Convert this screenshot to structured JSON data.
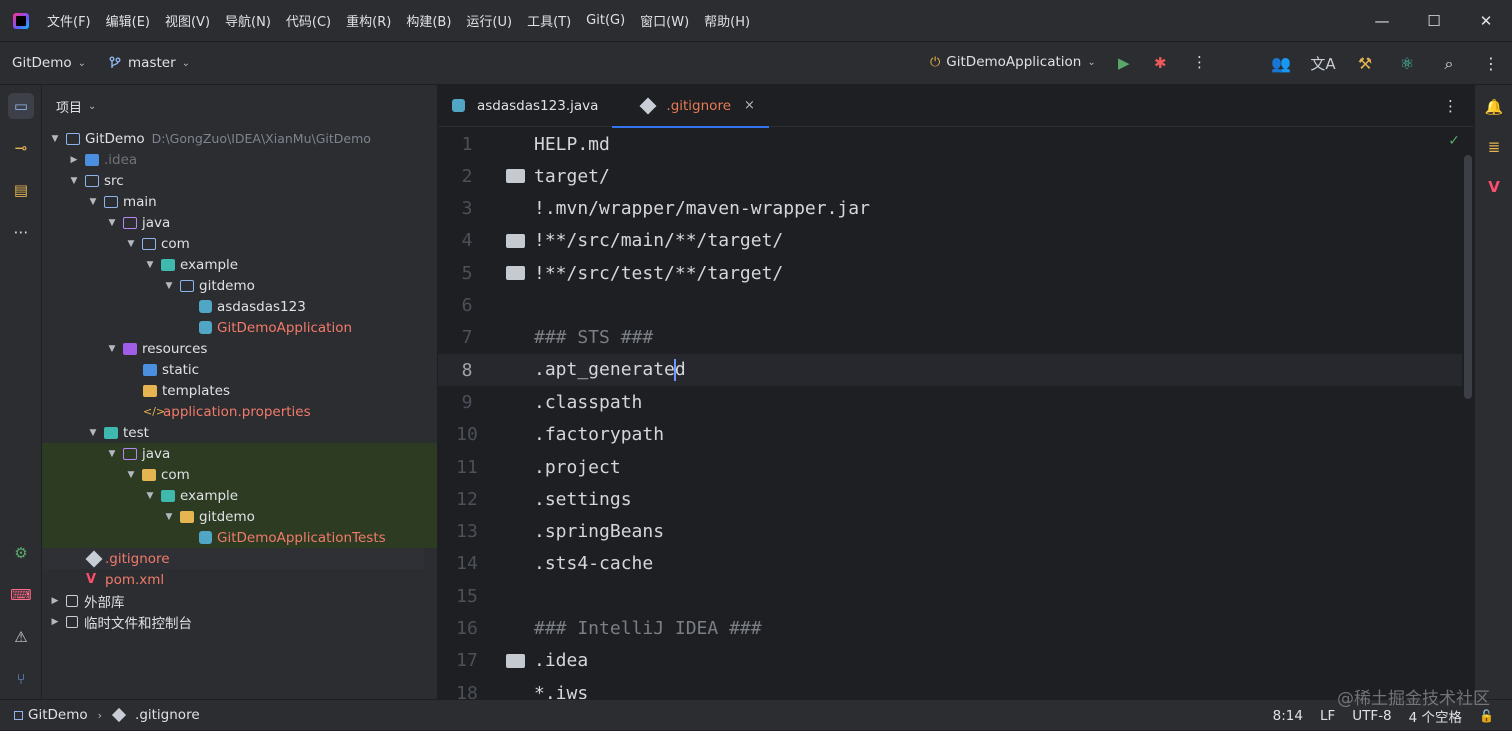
{
  "menu": [
    "文件(F)",
    "编辑(E)",
    "视图(V)",
    "导航(N)",
    "代码(C)",
    "重构(R)",
    "构建(B)",
    "运行(U)",
    "工具(T)",
    "Git(G)",
    "窗口(W)",
    "帮助(H)"
  ],
  "window": {
    "minimize": "—",
    "maximize": "☐",
    "close": "✕"
  },
  "toolbar": {
    "project": "GitDemo",
    "branch": "master",
    "run_config": "GitDemoApplication"
  },
  "project_panel": {
    "title": "项目"
  },
  "tree": [
    {
      "label": "GitDemo",
      "path": "D:\\GongZuo\\IDEA\\XianMu\\GitDemo"
    },
    {
      "label": ".idea"
    },
    {
      "label": "src"
    },
    {
      "label": "main"
    },
    {
      "label": "java"
    },
    {
      "label": "com"
    },
    {
      "label": "example"
    },
    {
      "label": "gitdemo"
    },
    {
      "label": "asdasdas123"
    },
    {
      "label": "GitDemoApplication"
    },
    {
      "label": "resources"
    },
    {
      "label": "static"
    },
    {
      "label": "templates"
    },
    {
      "label": "application.properties"
    },
    {
      "label": "test"
    },
    {
      "label": "java"
    },
    {
      "label": "com"
    },
    {
      "label": "example"
    },
    {
      "label": "gitdemo"
    },
    {
      "label": "GitDemoApplicationTests"
    },
    {
      "label": ".gitignore"
    },
    {
      "label": "pom.xml"
    },
    {
      "label": "外部库"
    },
    {
      "label": "临时文件和控制台"
    }
  ],
  "tabs": [
    {
      "label": "asdasdas123.java"
    },
    {
      "label": ".gitignore",
      "close": "×"
    }
  ],
  "editor": {
    "lines": [
      {
        "n": "1",
        "text": "HELP.md"
      },
      {
        "n": "2",
        "text": "target/"
      },
      {
        "n": "3",
        "text": "!.mvn/wrapper/maven-wrapper.jar"
      },
      {
        "n": "4",
        "text": "!**/src/main/**/target/"
      },
      {
        "n": "5",
        "text": "!**/src/test/**/target/"
      },
      {
        "n": "6",
        "text": ""
      },
      {
        "n": "7",
        "text": "### STS ###"
      },
      {
        "n": "8",
        "text_before": ".apt_generate",
        "text_after": "d"
      },
      {
        "n": "9",
        "text": ".classpath"
      },
      {
        "n": "10",
        "text": ".factorypath"
      },
      {
        "n": "11",
        "text": ".project"
      },
      {
        "n": "12",
        "text": ".settings"
      },
      {
        "n": "13",
        "text": ".springBeans"
      },
      {
        "n": "14",
        "text": ".sts4-cache"
      },
      {
        "n": "15",
        "text": ""
      },
      {
        "n": "16",
        "text": "### IntelliJ IDEA ###"
      },
      {
        "n": "17",
        "text": ".idea"
      },
      {
        "n": "18",
        "text": "*.iws"
      }
    ]
  },
  "statusbar": {
    "project": "GitDemo",
    "file": ".gitignore",
    "position": "8:14",
    "line_sep": "LF",
    "encoding": "UTF-8",
    "indent": "4 个空格"
  },
  "watermark": "@稀土掘金技术社区",
  "colors": {
    "accent": "#3574f0",
    "bg": "#1e1f22",
    "panel": "#2b2d30",
    "tab_active": "#e67a54",
    "vcs_modified": "#f27a6a"
  }
}
